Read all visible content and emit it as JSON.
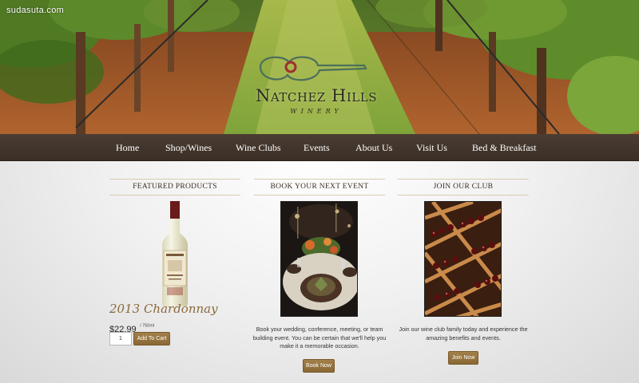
{
  "watermark": "sudasuta.com",
  "brand": {
    "name": "Natchez Hills",
    "subtitle": "WINERY"
  },
  "nav": {
    "items": [
      {
        "label": "Home"
      },
      {
        "label": "Shop/Wines"
      },
      {
        "label": "Wine Clubs"
      },
      {
        "label": "Events"
      },
      {
        "label": "About Us"
      },
      {
        "label": "Visit Us"
      },
      {
        "label": "Bed & Breakfast"
      }
    ]
  },
  "featured": {
    "heading": "FEATURED PRODUCTS",
    "product_name": "2013 Chardonnay",
    "price": "$22.99",
    "price_unit": "/ 750ml",
    "quantity": "1",
    "add_to_cart_label": "Add To Cart"
  },
  "events": {
    "heading": "BOOK YOUR NEXT EVENT",
    "description": "Book your wedding, conference, meeting, or team building event. You can be certain that we'll help you make it a memorable occasion.",
    "button_label": "Book Now"
  },
  "club": {
    "heading": "JOIN OUR CLUB",
    "description": "Join our wine club family today and experience the amazing benefits and events.",
    "button_label": "Join Now"
  },
  "colors": {
    "nav_bg": "#3f322a",
    "accent": "#967440",
    "product_title": "#8a6a3a"
  }
}
